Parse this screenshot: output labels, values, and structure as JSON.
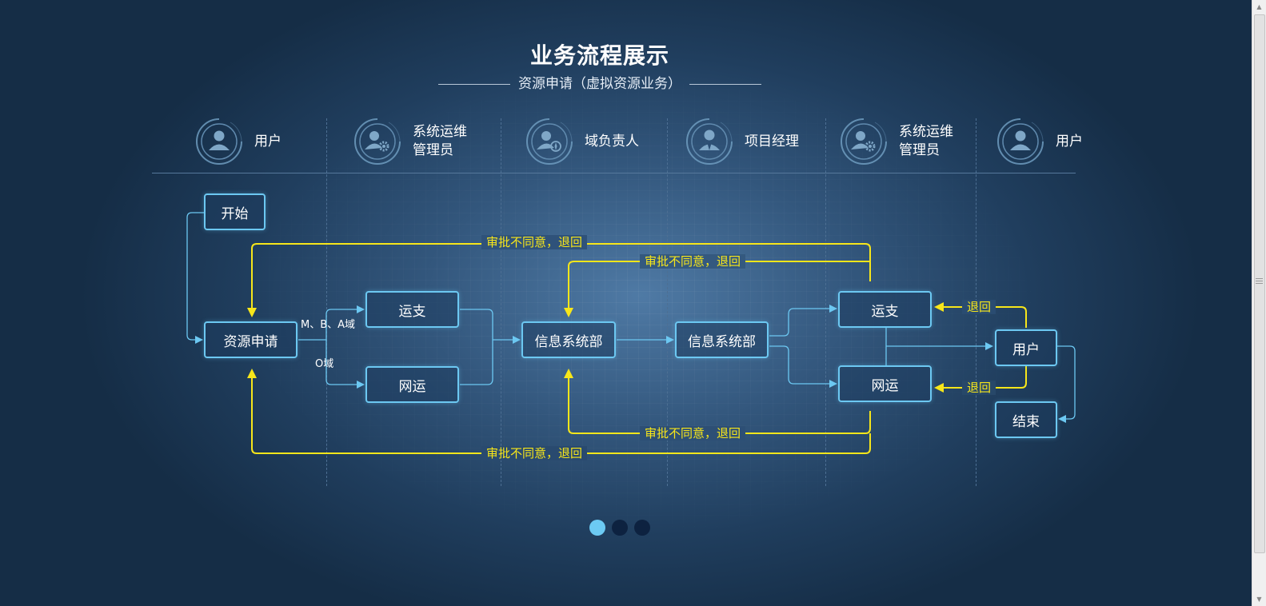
{
  "header": {
    "title": "业务流程展示",
    "subtitle": "资源申请（虚拟资源业务）"
  },
  "roles": [
    {
      "label": "用户",
      "icon": "user-icon"
    },
    {
      "label": "系统运维\n管理员",
      "icon": "user-gear-icon"
    },
    {
      "label": "域负责人",
      "icon": "user-compass-icon"
    },
    {
      "label": "项目经理",
      "icon": "user-tie-icon"
    },
    {
      "label": "系统运维\n管理员",
      "icon": "user-gear-icon"
    },
    {
      "label": "用户",
      "icon": "user-icon"
    }
  ],
  "nodes": {
    "start": "开始",
    "apply": "资源申请",
    "yunzhi_1": "运支",
    "wangyun_1": "网运",
    "info_dept_1": "信息系统部",
    "info_dept_2": "信息系统部",
    "yunzhi_2": "运支",
    "wangyun_2": "网运",
    "user": "用户",
    "end": "结束"
  },
  "edge_labels": {
    "mba_domain": "M、B、A域",
    "o_domain": "O域",
    "reject_top_outer": "审批不同意，退回",
    "reject_top_inner": "审批不同意，退回",
    "reject_bottom_inner": "审批不同意，退回",
    "reject_bottom_outer": "审批不同意，退回",
    "return_upper": "退回",
    "return_lower": "退回"
  },
  "pager": {
    "count": 3,
    "active_index": 0
  },
  "colors": {
    "accent_line": "#6cc8f2",
    "reject_line": "#f7e61a",
    "background": "#2b4d73"
  }
}
